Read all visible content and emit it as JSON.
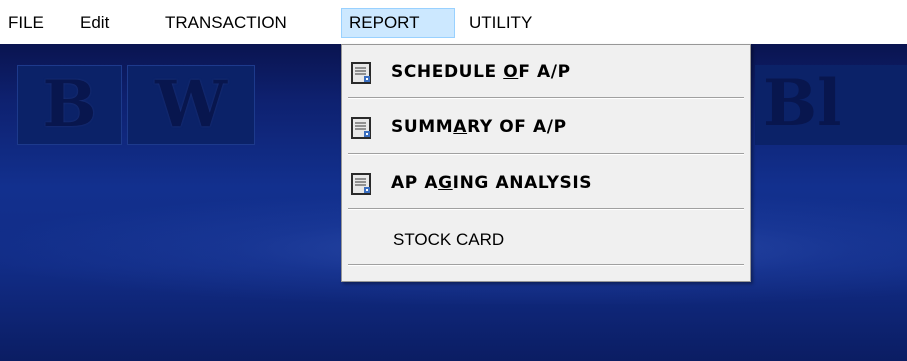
{
  "menubar": {
    "items": [
      "FILE",
      "Edit",
      "TRANSACTION",
      "REPORT",
      "UTILITY"
    ],
    "active": "REPORT"
  },
  "background": {
    "logo_letters": [
      "B",
      "W",
      "Bl"
    ],
    "color": "#12308e"
  },
  "report_menu": {
    "items": [
      {
        "label_pre": "SCHEDULE ",
        "label_ul": "O",
        "label_post": "F A/P",
        "icon": "report-document-icon"
      },
      {
        "label_pre": "SUMM",
        "label_ul": "A",
        "label_post": "RY OF A/P",
        "icon": "report-document-icon"
      },
      {
        "label_pre": "AP A",
        "label_ul": "G",
        "label_post": "ING ANALYSIS",
        "icon": "report-document-icon"
      },
      {
        "label_pre": "STOCK CARD",
        "label_ul": "",
        "label_post": "",
        "icon": ""
      }
    ]
  }
}
